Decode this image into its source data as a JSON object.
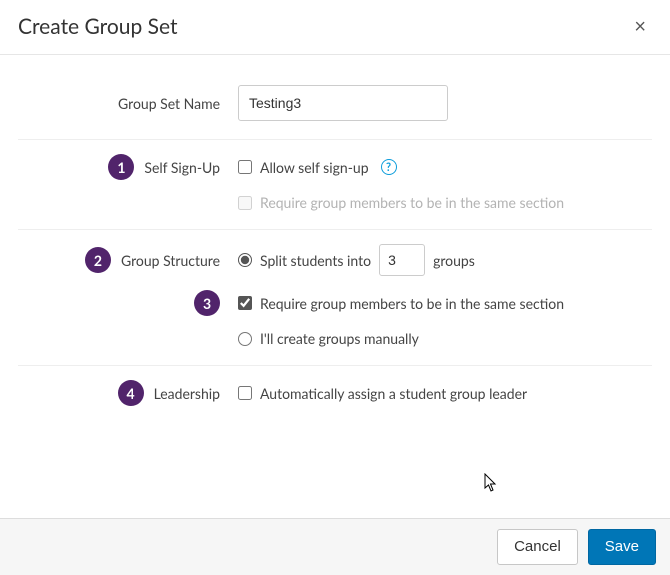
{
  "header": {
    "title": "Create Group Set",
    "close_glyph": "×"
  },
  "badges": {
    "self_sign_up": "1",
    "group_structure": "2",
    "same_section": "3",
    "leadership": "4"
  },
  "labels": {
    "group_set_name": "Group Set Name",
    "self_sign_up": "Self Sign-Up",
    "group_structure": "Group Structure",
    "leadership": "Leadership"
  },
  "fields": {
    "group_set_name_value": "Testing3",
    "allow_self_sign_up": "Allow self sign-up",
    "help_glyph": "?",
    "require_same_section_signup": "Require group members to be in the same section",
    "split_prefix": "Split students into",
    "split_count": "3",
    "split_suffix": "groups",
    "require_same_section_split": "Require group members to be in the same section",
    "manual_create": "I'll create groups manually",
    "auto_leader": "Automatically assign a student group leader"
  },
  "footer": {
    "cancel": "Cancel",
    "save": "Save"
  }
}
